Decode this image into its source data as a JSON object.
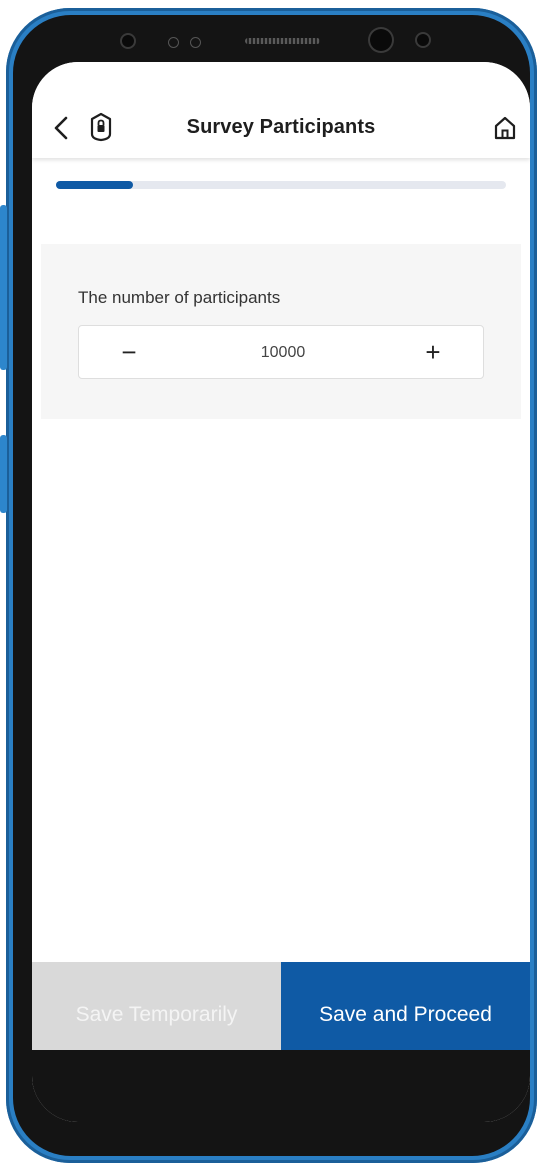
{
  "header": {
    "title": "Survey Participants",
    "back_icon": "chevron-left-icon",
    "badge_icon": "shield-lock-icon",
    "home_icon": "home-icon"
  },
  "progress": {
    "percent": 17,
    "fill_color": "#0f5aa5",
    "track_color": "#e5e8ef"
  },
  "form": {
    "participants_label": "The number of participants",
    "participants_value": "10000",
    "decrement_symbol": "−",
    "increment_symbol": "+"
  },
  "footer": {
    "save_temporarily_label": "Save Temporarily",
    "save_proceed_label": "Save and Proceed"
  },
  "colors": {
    "accent": "#0f5aa5",
    "disabled_button": "#d9d9d9",
    "device_frame": "#2a7fc4"
  }
}
